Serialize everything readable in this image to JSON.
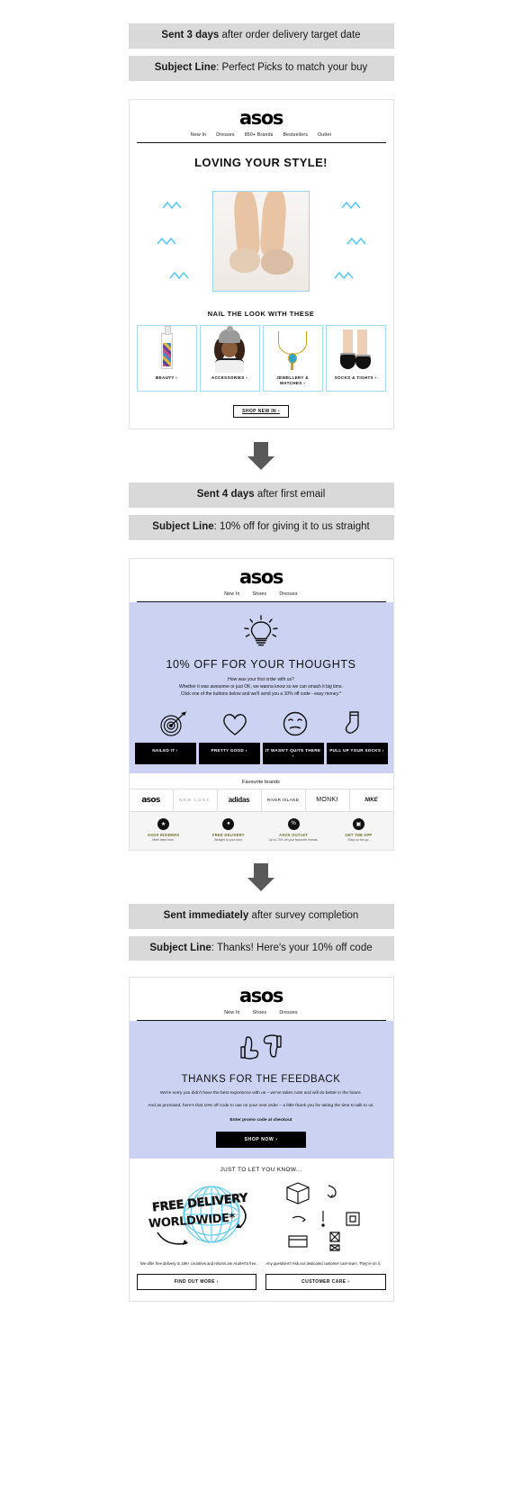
{
  "flow": [
    {
      "timing_prefix": "Sent 3 days",
      "timing_rest": " after order delivery target date",
      "subject_label": "Subject Line",
      "subject_text": ": Perfect Picks to match your buy"
    },
    {
      "timing_prefix": "Sent 4 days",
      "timing_rest": " after first email",
      "subject_label": "Subject Line",
      "subject_text": ": 10% off for giving it to us straight"
    },
    {
      "timing_prefix": "Sent immediately",
      "timing_rest": " after survey completion",
      "subject_label": "Subject Line",
      "subject_text": ": Thanks! Here's your 10% off code"
    }
  ],
  "brand": {
    "logo": "asos"
  },
  "email1": {
    "nav": [
      "New In",
      "Dresses",
      "850+ Brands",
      "Bestsellers",
      "Outlet"
    ],
    "headline": "LOVING YOUR STYLE!",
    "subhead": "NAIL THE LOOK WITH THESE",
    "categories": [
      {
        "label": "BEAUTY ›"
      },
      {
        "label": "ACCESSORIES ›"
      },
      {
        "label": "JEWELLERY & WATCHES ›"
      },
      {
        "label": "SOCKS & TIGHTS ›"
      }
    ],
    "cta": "SHOP NEW IN ›"
  },
  "email2": {
    "nav": [
      "New In",
      "Shoes",
      "Dresses"
    ],
    "headline": "10% OFF FOR YOUR THOUGHTS",
    "body_line1": "How was your first order with us?",
    "body_line2": "Whether it was awesome or just OK, we wanna know so we can smash it big time.",
    "body_line3": "Click one of the buttons below and we'll send you a 10% off code - easy money.*",
    "emojis": [
      "target-icon",
      "heart-icon",
      "neutral-face-icon",
      "sock-icon"
    ],
    "buttons": [
      "NAILED IT ›",
      "PRETTY GOOD ›",
      "IT WASN'T QUITE THERE ›",
      "PULL UP YOUR SOCKS ›"
    ],
    "favourites_heading": "Favourite brands",
    "brands": [
      "asos",
      "NEW LOOK",
      "adidas",
      "RIVER ISLAND",
      "MONKI",
      "NIKE"
    ],
    "perks": [
      {
        "title": "ASOS INSIDERS",
        "sub": "Meet them here."
      },
      {
        "title": "FREE DELIVERY",
        "sub": "Straight to your door."
      },
      {
        "title": "ASOS OUTLET",
        "sub": "Up to 70% off your favourite brands."
      },
      {
        "title": "GET THE APP",
        "sub": "Shop on the go."
      }
    ]
  },
  "email3": {
    "nav": [
      "New In",
      "Shoes",
      "Dresses"
    ],
    "headline": "THANKS FOR THE FEEDBACK",
    "body_line1": "We're sorry you didn't have the best experience with us – we've taken note and will do better in the future.",
    "body_line2": "And as promised, here's that 10% off code to use on your next order – a little thank you for taking the time to talk to us.",
    "enter_code": "Enter promo code at checkout",
    "cta": "SHOP NOW ›",
    "just_to_let_you_know": "JUST TO LET YOU KNOW...",
    "free_delivery_line1": "FREE DELIVERY",
    "free_delivery_line2": "WORLDWIDE*",
    "footer_left": "We offer free delivery to 196+ countries and returns are ALWAYS free.",
    "footer_right": "Any questions? Ask our dedicated customer care team. They're on it.",
    "footer_btn_left": "FIND OUT MORE ›",
    "footer_btn_right": "CUSTOMER CARE ›"
  },
  "colors": {
    "banner_bg": "#d9d9d9",
    "lavender": "#ccd3f2",
    "accent_blue": "#9fd4ef",
    "black": "#000000",
    "arrow_gray": "#595959"
  }
}
